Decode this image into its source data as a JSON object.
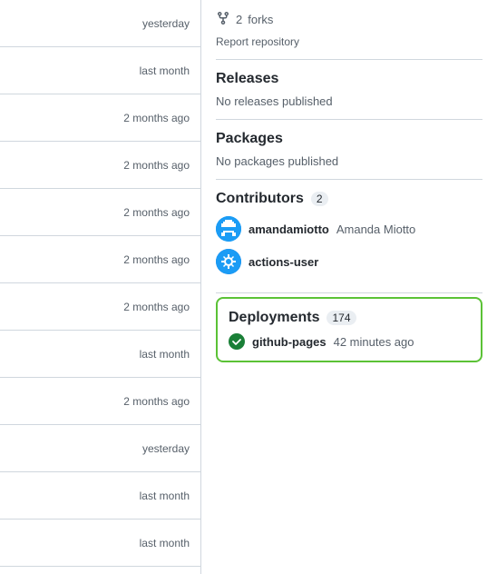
{
  "leftCol": {
    "timestamps": [
      "yesterday",
      "last month",
      "2 months ago",
      "2 months ago",
      "2 months ago",
      "2 months ago",
      "2 months ago",
      "last month",
      "2 months ago",
      "yesterday",
      "last month",
      "last month"
    ]
  },
  "rightCol": {
    "forks": {
      "count": "2",
      "label": "forks",
      "reportText": "Report repository"
    },
    "releases": {
      "heading": "Releases",
      "emptyText": "No releases published"
    },
    "packages": {
      "heading": "Packages",
      "emptyText": "No packages published"
    },
    "contributors": {
      "heading": "Contributors",
      "count": "2",
      "users": [
        {
          "username": "amandamiotto",
          "fullname": "Amanda Miotto"
        },
        {
          "username": "actions-user",
          "fullname": ""
        }
      ]
    },
    "deployments": {
      "heading": "Deployments",
      "count": "174",
      "items": [
        {
          "name": "github-pages",
          "time": "42 minutes ago"
        }
      ]
    }
  }
}
